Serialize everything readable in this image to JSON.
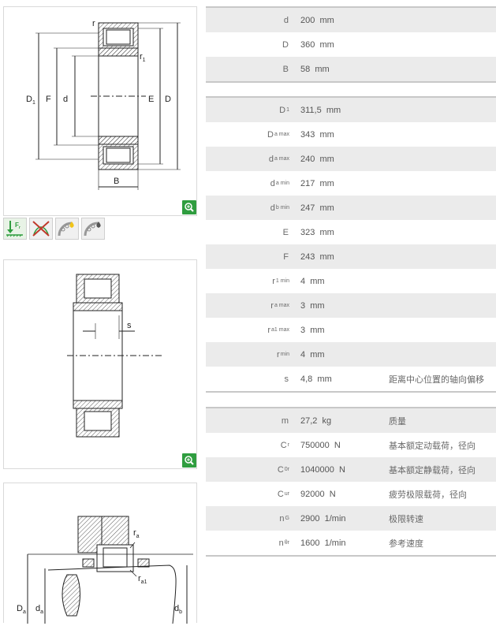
{
  "drawing_labels": {
    "r": "r",
    "r1": "r",
    "r1_sub": "1",
    "D1": "D",
    "D1_sub": "1",
    "F": "F",
    "d": "d",
    "E": "E",
    "D": "D",
    "B": "B",
    "s": "s",
    "ra": "r",
    "ra_sub": "a",
    "ra1": "r",
    "ra1_sub": "a1",
    "Da": "D",
    "Da_sub": "a",
    "da": "d",
    "da_sub": "a",
    "db": "d",
    "db_sub": "b"
  },
  "dimensions_main": [
    {
      "symbol": "d",
      "sub": "",
      "value": "200",
      "unit": "mm"
    },
    {
      "symbol": "D",
      "sub": "",
      "value": "360",
      "unit": "mm"
    },
    {
      "symbol": "B",
      "sub": "",
      "value": "58",
      "unit": "mm"
    }
  ],
  "dimensions_detail": [
    {
      "symbol": "D",
      "sub": "1",
      "value": "311,5",
      "unit": "mm",
      "desc": ""
    },
    {
      "symbol": "D",
      "sub": "a max",
      "value": "343",
      "unit": "mm",
      "desc": ""
    },
    {
      "symbol": "d",
      "sub": "a max",
      "value": "240",
      "unit": "mm",
      "desc": ""
    },
    {
      "symbol": "d",
      "sub": "a min",
      "value": "217",
      "unit": "mm",
      "desc": ""
    },
    {
      "symbol": "d",
      "sub": "b min",
      "value": "247",
      "unit": "mm",
      "desc": ""
    },
    {
      "symbol": "E",
      "sub": "",
      "value": "323",
      "unit": "mm",
      "desc": ""
    },
    {
      "symbol": "F",
      "sub": "",
      "value": "243",
      "unit": "mm",
      "desc": ""
    },
    {
      "symbol": "r",
      "sub": "1 min",
      "value": "4",
      "unit": "mm",
      "desc": ""
    },
    {
      "symbol": "r",
      "sub": "a max",
      "value": "3",
      "unit": "mm",
      "desc": ""
    },
    {
      "symbol": "r",
      "sub": "a1 max",
      "value": "3",
      "unit": "mm",
      "desc": ""
    },
    {
      "symbol": "r",
      "sub": "min",
      "value": "4",
      "unit": "mm",
      "desc": ""
    },
    {
      "symbol": "s",
      "sub": "",
      "value": "4,8",
      "unit": "mm",
      "desc": "距离中心位置的轴向偏移"
    }
  ],
  "performance": [
    {
      "symbol": "m",
      "sub": "",
      "value": "27,2",
      "unit": "kg",
      "desc": "质量"
    },
    {
      "symbol": "C",
      "sub": "r",
      "value": "750000",
      "unit": "N",
      "desc": "基本额定动载荷，径向"
    },
    {
      "symbol": "C",
      "sub": "0r",
      "value": "1040000",
      "unit": "N",
      "desc": "基本额定静载荷，径向"
    },
    {
      "symbol": "C",
      "sub": "ur",
      "value": "92000",
      "unit": "N",
      "desc": "疲劳极限载荷，径向"
    },
    {
      "symbol": "n",
      "sub": "G",
      "value": "2900",
      "unit": "1/min",
      "desc": "极限转速"
    },
    {
      "symbol": "n",
      "sub": "θr",
      "value": "1600",
      "unit": "1/min",
      "desc": "参考速度"
    }
  ],
  "feature_icons": [
    "axial-load-icon",
    "no-axial-displacement-icon",
    "grease-lubrication-icon",
    "oil-lubrication-icon"
  ],
  "feature_icon_text": {
    "Fr": "F",
    "Fr_sub": "r"
  },
  "colors": {
    "zoom": "#2f9d3f",
    "row_alt": "#ebebeb",
    "border": "#c8c8c8"
  }
}
